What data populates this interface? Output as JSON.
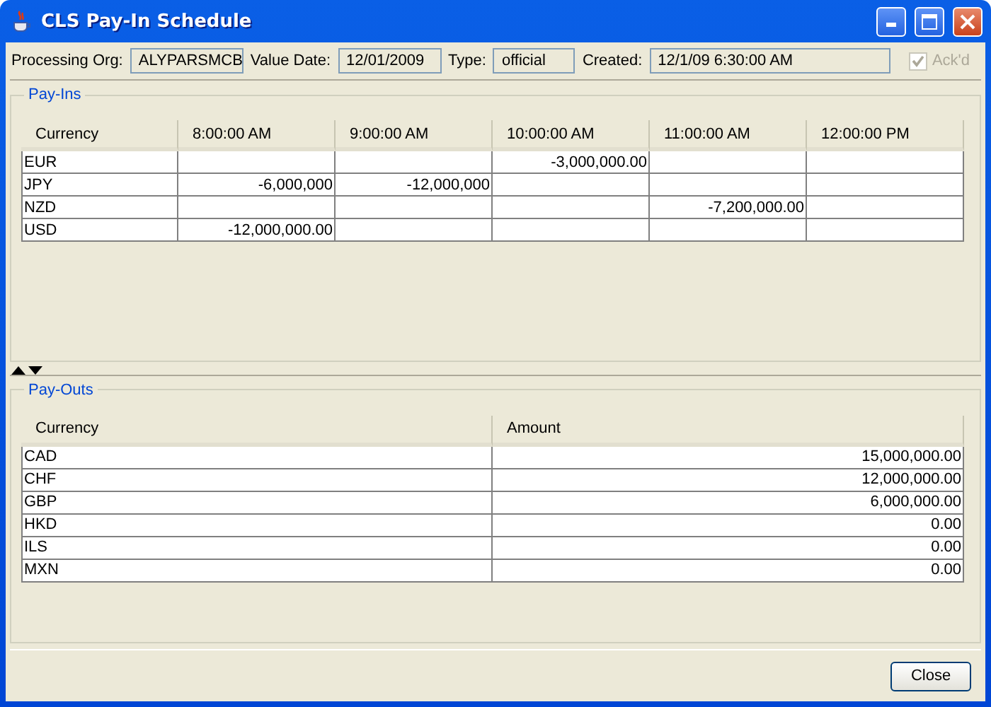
{
  "window": {
    "title": "CLS Pay-In Schedule"
  },
  "header": {
    "fields": [
      {
        "label": "Processing Org:",
        "value": "ALYPARSMCB"
      },
      {
        "label": "Value Date:",
        "value": "12/01/2009"
      },
      {
        "label": "Type:",
        "value": "official"
      },
      {
        "label": "Created:",
        "value": "12/1/09 6:30:00 AM"
      }
    ],
    "ackd": {
      "label": "Ack'd",
      "checked": true,
      "disabled": true
    }
  },
  "pay_ins": {
    "title": "Pay-Ins",
    "columns": [
      "Currency",
      "8:00:00 AM",
      "9:00:00 AM",
      "10:00:00 AM",
      "11:00:00 AM",
      "12:00:00 PM"
    ],
    "rows": [
      [
        "EUR",
        "",
        "",
        "-3,000,000.00",
        "",
        ""
      ],
      [
        "JPY",
        "-6,000,000",
        "-12,000,000",
        "",
        "",
        ""
      ],
      [
        "NZD",
        "",
        "",
        "",
        "-7,200,000.00",
        ""
      ],
      [
        "USD",
        "-12,000,000.00",
        "",
        "",
        "",
        ""
      ]
    ]
  },
  "pay_outs": {
    "title": "Pay-Outs",
    "columns": [
      "Currency",
      "Amount"
    ],
    "rows": [
      [
        "CAD",
        "15,000,000.00"
      ],
      [
        "CHF",
        "12,000,000.00"
      ],
      [
        "GBP",
        "6,000,000.00"
      ],
      [
        "HKD",
        "0.00"
      ],
      [
        "ILS",
        "0.00"
      ],
      [
        "MXN",
        "0.00"
      ]
    ]
  },
  "buttons": [
    {
      "label": "Close"
    }
  ]
}
